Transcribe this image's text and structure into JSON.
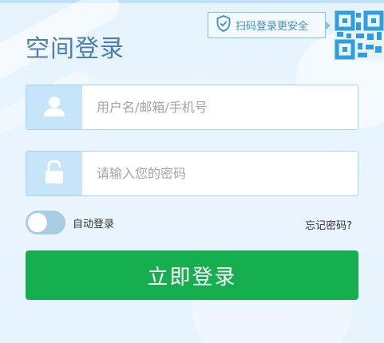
{
  "header": {
    "title": "空间登录"
  },
  "qr_tip": {
    "text": "扫码登录更安全",
    "icon": "shield-check-icon"
  },
  "qr_code": {
    "icon": "qr-code-icon"
  },
  "username": {
    "placeholder": "用户名/邮箱/手机号",
    "value": "",
    "icon": "user-icon"
  },
  "password": {
    "placeholder": "请输入您的密码",
    "value": "",
    "icon": "lock-icon"
  },
  "remember": {
    "label": "自动登录",
    "enabled": false
  },
  "forgot": {
    "label": "忘记密码?"
  },
  "login_button": {
    "label": "立即登录"
  },
  "colors": {
    "title": "#4a7fb0",
    "accent_blue": "#3d8fc9",
    "button_green": "#16af50",
    "icon_bg": "#c6e4fa",
    "border": "#a9d2ee"
  }
}
